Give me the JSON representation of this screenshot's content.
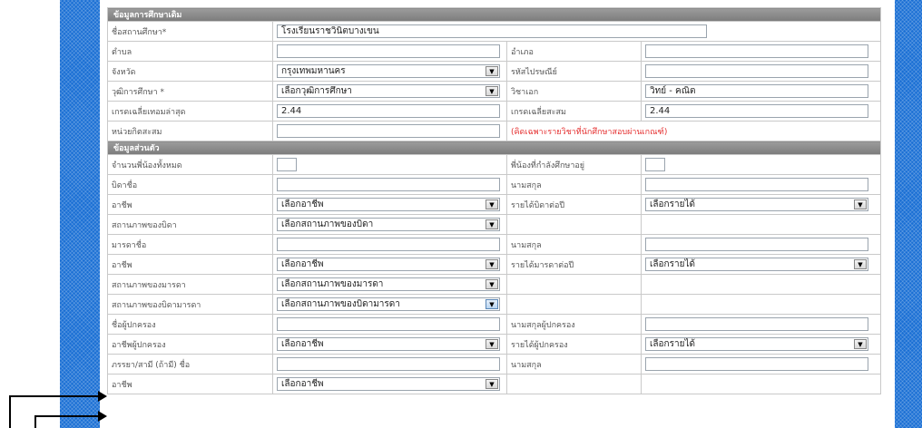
{
  "education": {
    "section_title": "ข้อมูลการศึกษาเดิม",
    "school_name_label": "ชื่อสถานศึกษา*",
    "school_name_value": "โรงเรียนราชวินิตบางเขน",
    "subdistrict_label": "ตำบล",
    "subdistrict_value": "",
    "district_label": "อำเภอ",
    "district_value": "",
    "province_label": "จังหวัด",
    "province_value": "กรุงเทพมหานคร",
    "postal_label": "รหัสไปรษณีย์",
    "postal_value": "",
    "qualification_label": "วุฒิการศึกษา *",
    "qualification_value": "เลือกวุฒิการศึกษา",
    "major_label": "วิชาเอก",
    "major_value": "วิทย์ - คณิต",
    "latest_gpa_label": "เกรดเฉลี่ยเทอมล่าสุด",
    "latest_gpa_value": "2.44",
    "cumulative_gpa_label": "เกรดเฉลี่ยสะสม",
    "cumulative_gpa_value": "2.44",
    "credits_label": "หน่วยกิตสะสม",
    "credits_value": "",
    "credits_note": "(คิดเฉพาะรายวิชาที่นักศึกษาสอบผ่านเกณฑ์)"
  },
  "personal": {
    "section_title": "ข้อมูลส่วนตัว",
    "siblings_total_label": "จำนวนพี่น้องทั้งหมด",
    "siblings_total_value": "",
    "siblings_studying_label": "พี่น้องที่กำลังศึกษาอยู่",
    "siblings_studying_value": "",
    "father_name_label": "บิดาชื่อ",
    "father_name_value": "",
    "father_surname_label": "นามสกุล",
    "father_surname_value": "",
    "father_occupation_label": "อาชีพ",
    "father_occupation_value": "เลือกอาชีพ",
    "father_income_label": "รายได้บิดาต่อปี",
    "father_income_value": "เลือกรายได้",
    "father_status_label": "สถานภาพของบิดา",
    "father_status_value": "เลือกสถานภาพของบิดา",
    "mother_name_label": "มารดาชื่อ",
    "mother_name_value": "",
    "mother_surname_label": "นามสกุล",
    "mother_surname_value": "",
    "mother_occupation_label": "อาชีพ",
    "mother_occupation_value": "เลือกอาชีพ",
    "mother_income_label": "รายได้มารดาต่อปี",
    "mother_income_value": "เลือกรายได้",
    "mother_status_label": "สถานภาพของมารดา",
    "mother_status_value": "เลือกสถานภาพของมารดา",
    "parents_status_label": "สถานภาพของบิดามารดา",
    "parents_status_value": "เลือกสถานภาพของบิดามารดา",
    "guardian_name_label": "ชื่อผู้ปกครอง",
    "guardian_name_value": "",
    "guardian_surname_label": "นามสกุลผู้ปกครอง",
    "guardian_surname_value": "",
    "guardian_occupation_label": "อาชีพผู้ปกครอง",
    "guardian_occupation_value": "เลือกอาชีพ",
    "guardian_income_label": "รายได้ผู้ปกครอง",
    "guardian_income_value": "เลือกรายได้",
    "spouse_name_label": "ภรรยา/สามี (ถ้ามี) ชื่อ",
    "spouse_name_value": "",
    "spouse_surname_label": "นามสกุล",
    "spouse_surname_value": "",
    "spouse_occupation_label": "อาชีพ",
    "spouse_occupation_value": "เลือกอาชีพ"
  },
  "icons": {
    "dropdown_arrow": "▼"
  },
  "colors": {
    "side_panel": "#1a6fd4",
    "section_header": "#8a8a8a",
    "note_red": "#e53030",
    "annotation_arrow": "#000000"
  }
}
